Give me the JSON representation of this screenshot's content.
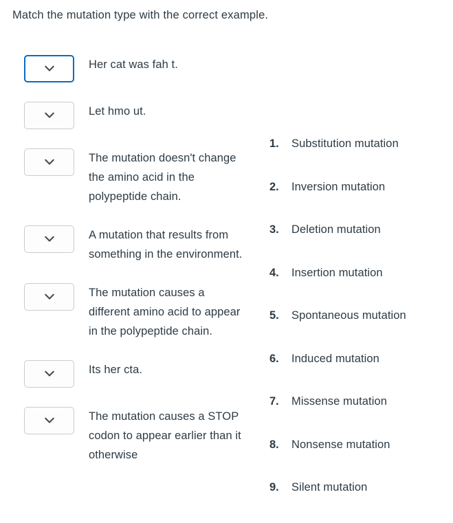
{
  "prompt": "Match the mutation type with the correct example.",
  "dropdown": {
    "icon": "chevron-down-icon",
    "selected_value": "",
    "focus_border_color": "#0a6cbd",
    "border_color": "#c7cdd1"
  },
  "answers": [
    {
      "text": "Her cat was fah t.",
      "focused": true
    },
    {
      "text": "Let hmo ut.",
      "focused": false
    },
    {
      "text": "The mutation doesn't change the amino acid in the polypeptide chain.",
      "focused": false
    },
    {
      "text": "A mutation that results from something in the environment.",
      "focused": false
    },
    {
      "text": "The mutation causes a different amino acid to appear in the polypeptide chain.",
      "focused": false
    },
    {
      "text": "Its her cta.",
      "focused": false
    },
    {
      "text": "The mutation causes a STOP codon to appear earlier than it otherwise",
      "focused": false
    }
  ],
  "choices": [
    {
      "number": "1.",
      "label": "Substitution mutation"
    },
    {
      "number": "2.",
      "label": "Inversion mutation"
    },
    {
      "number": "3.",
      "label": "Deletion mutation"
    },
    {
      "number": "4.",
      "label": "Insertion mutation"
    },
    {
      "number": "5.",
      "label": "Spontaneous mutation"
    },
    {
      "number": "6.",
      "label": "Induced mutation"
    },
    {
      "number": "7.",
      "label": "Missense mutation"
    },
    {
      "number": "8.",
      "label": "Nonsense mutation"
    },
    {
      "number": "9.",
      "label": "Silent mutation"
    }
  ],
  "colors": {
    "text": "#2d3b45",
    "background": "#ffffff",
    "focus_blue": "#0a6cbd"
  }
}
